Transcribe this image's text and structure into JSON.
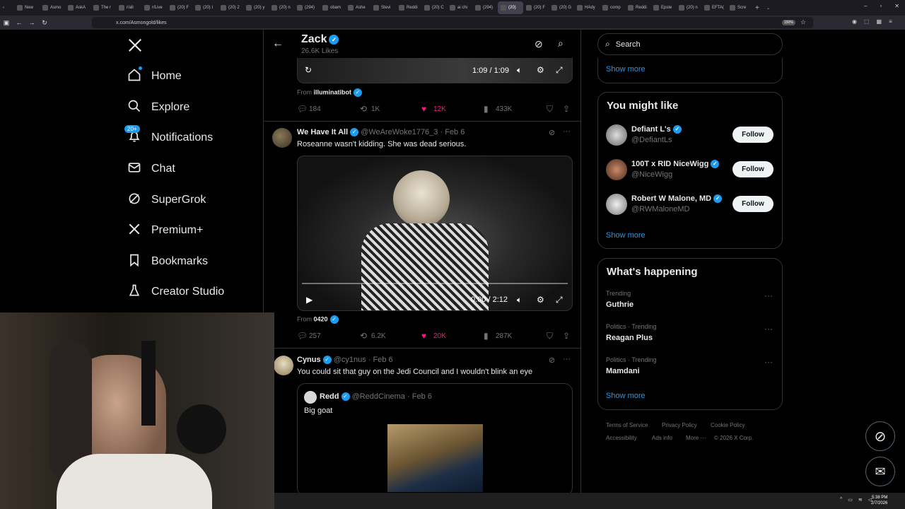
{
  "browser": {
    "tabs": [
      "New",
      "Asmo",
      "AskA",
      "The r",
      "r/all",
      "r/Live",
      "(20) F",
      "(20) I",
      "(20) 2",
      "(20) y",
      "(20) n",
      "(294)",
      "obam",
      "Ashe",
      "Stevi",
      "Reddi",
      "(20) C",
      "ai chi",
      "(294)",
      "(20)",
      "(20) F",
      "(20) G",
      "HAdy",
      "comp",
      "Reddi",
      "Epste",
      "(20) n",
      "EFTA(",
      "Scre"
    ],
    "active_tab_index": 19,
    "url": "x.com/Asmongold/likes",
    "zoom": "150%"
  },
  "sidebar": {
    "items": [
      {
        "label": "Home",
        "icon": "home-icon"
      },
      {
        "label": "Explore",
        "icon": "search-icon"
      },
      {
        "label": "Notifications",
        "icon": "bell-icon",
        "badge": "20+"
      },
      {
        "label": "Chat",
        "icon": "mail-icon"
      },
      {
        "label": "SuperGrok",
        "icon": "grok-icon"
      },
      {
        "label": "Premium+",
        "icon": "x-logo-icon"
      },
      {
        "label": "Bookmarks",
        "icon": "bookmark-icon"
      },
      {
        "label": "Creator Studio",
        "icon": "flask-icon"
      }
    ]
  },
  "profile": {
    "name": "Zack",
    "likes_count": "26.6K Likes"
  },
  "posts": [
    {
      "video_time": "1:09 / 1:09",
      "from_label": "From",
      "from_account": "illuminatibot",
      "stats": {
        "replies": "184",
        "reposts": "1K",
        "likes": "12K",
        "views": "433K"
      }
    },
    {
      "author": "We Have It All",
      "handle": "@WeAreWoke1776_3",
      "date": "Feb 6",
      "text": "Roseanne wasn't kidding.  She was dead serious.",
      "video_time": "0:00 / 2:12",
      "video_progress": 0.0,
      "from_label": "From",
      "from_account": "0420",
      "stats": {
        "replies": "257",
        "reposts": "6.2K",
        "likes": "20K",
        "views": "287K"
      }
    },
    {
      "author": "Cynus",
      "handle": "@cy1nus",
      "date": "Feb 6",
      "text": "You could sit that guy on the Jedi Council and I wouldn't blink an eye",
      "quote": {
        "author": "Redd",
        "handle": "@ReddCinema",
        "date": "Feb 6",
        "text": "Big goat"
      }
    }
  ],
  "right": {
    "search_placeholder": "Search",
    "show_more": "Show more",
    "you_might_like": {
      "title": "You might like",
      "users": [
        {
          "name": "Defiant L's",
          "handle": "@DefiantLs",
          "button": "Follow"
        },
        {
          "name": "100T x RID NiceWigg",
          "handle": "@NiceWigg",
          "button": "Follow"
        },
        {
          "name": "Robert W Malone, MD",
          "handle": "@RWMaloneMD",
          "button": "Follow"
        }
      ]
    },
    "whats_happening": {
      "title": "What's happening",
      "trends": [
        {
          "meta": "Trending",
          "name": "Guthrie"
        },
        {
          "meta": "Politics · Trending",
          "name": "Reagan Plus"
        },
        {
          "meta": "Politics · Trending",
          "name": "Mamdani"
        }
      ]
    },
    "footer": {
      "links": [
        "Terms of Service",
        "Privacy Policy",
        "Cookie Policy",
        "Accessibility",
        "Ads info",
        "More ···",
        "© 2026 X Corp."
      ]
    }
  },
  "taskbar": {
    "time": "5:38 PM",
    "date": "2/7/2026"
  },
  "colors": {
    "accent": "#1d9bf0",
    "like_pink": "#f91880",
    "background": "#000000",
    "border": "#2f3336"
  }
}
